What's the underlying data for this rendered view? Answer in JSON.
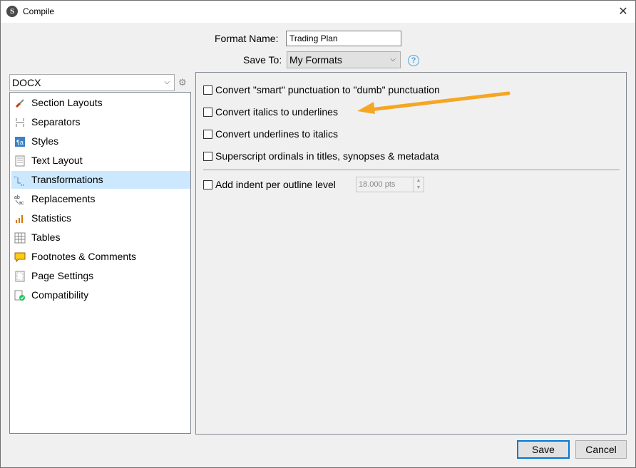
{
  "window": {
    "title": "Compile"
  },
  "format": {
    "name_label": "Format Name:",
    "name_value": "Trading Plan",
    "save_to_label": "Save To:",
    "save_to_value": "My Formats"
  },
  "output_type": {
    "value": "DOCX"
  },
  "sidebar": {
    "items": [
      {
        "label": "Section Layouts",
        "icon": "brush-icon"
      },
      {
        "label": "Separators",
        "icon": "separators-icon"
      },
      {
        "label": "Styles",
        "icon": "styles-icon"
      },
      {
        "label": "Text Layout",
        "icon": "text-layout-icon"
      },
      {
        "label": "Transformations",
        "icon": "transformations-icon",
        "selected": true
      },
      {
        "label": "Replacements",
        "icon": "replacements-icon"
      },
      {
        "label": "Statistics",
        "icon": "statistics-icon"
      },
      {
        "label": "Tables",
        "icon": "tables-icon"
      },
      {
        "label": "Footnotes & Comments",
        "icon": "footnotes-icon"
      },
      {
        "label": "Page Settings",
        "icon": "page-settings-icon"
      },
      {
        "label": "Compatibility",
        "icon": "compatibility-icon"
      }
    ]
  },
  "options": {
    "smart_punct": "Convert \"smart\" punctuation to \"dumb\" punctuation",
    "italics": "Convert italics to underlines",
    "underlines": "Convert underlines to italics",
    "superscript": "Superscript ordinals in titles, synopses & metadata",
    "indent": "Add indent per outline level",
    "indent_value": "18.000 pts"
  },
  "buttons": {
    "save": "Save",
    "cancel": "Cancel"
  },
  "colors": {
    "arrow": "#f5a623",
    "selection": "#cce8ff",
    "default_button_border": "#0078d7"
  }
}
